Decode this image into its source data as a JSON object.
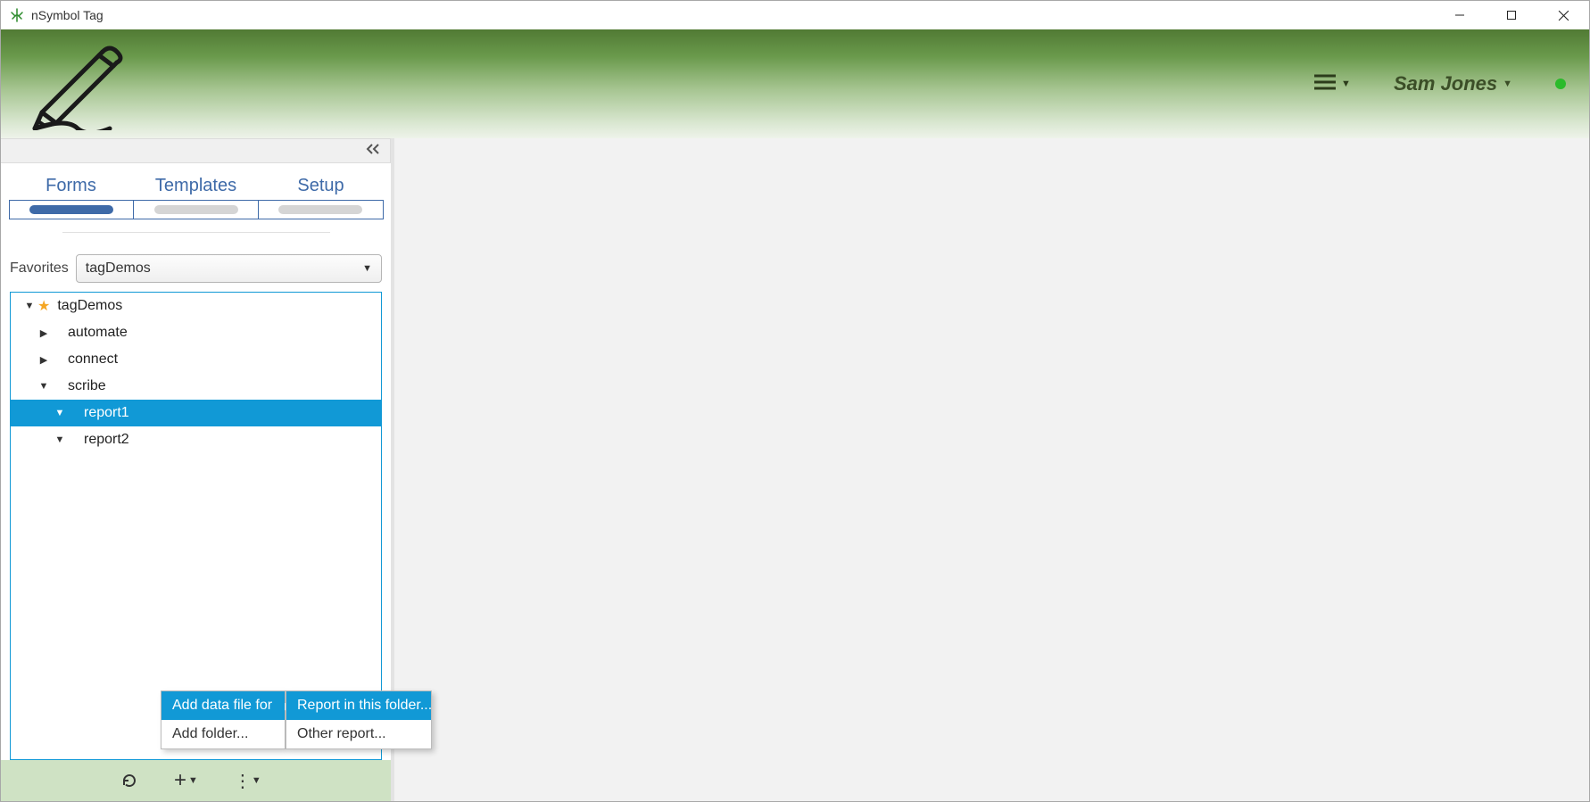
{
  "window": {
    "title": "nSymbol Tag"
  },
  "banner": {
    "user_name": "Sam Jones"
  },
  "sidebar": {
    "tabs": [
      {
        "label": "Forms",
        "active": true
      },
      {
        "label": "Templates",
        "active": false
      },
      {
        "label": "Setup",
        "active": false
      }
    ],
    "favorites_label": "Favorites",
    "favorites_selected": "tagDemos",
    "tree": {
      "root": "tagDemos",
      "items": [
        {
          "label": "automate",
          "expanded": false
        },
        {
          "label": "connect",
          "expanded": false
        },
        {
          "label": "scribe",
          "expanded": true,
          "children": [
            {
              "label": "report1",
              "selected": true
            },
            {
              "label": "report2",
              "selected": false
            }
          ]
        }
      ]
    }
  },
  "context_menu": {
    "primary": [
      {
        "label": "Add data file for",
        "submenu": true,
        "highlight": true
      },
      {
        "label": "Add folder...",
        "submenu": false,
        "highlight": false
      }
    ],
    "submenu": [
      {
        "label": "Report in this folder...",
        "highlight": true
      },
      {
        "label": "Other report...",
        "highlight": false
      }
    ]
  }
}
